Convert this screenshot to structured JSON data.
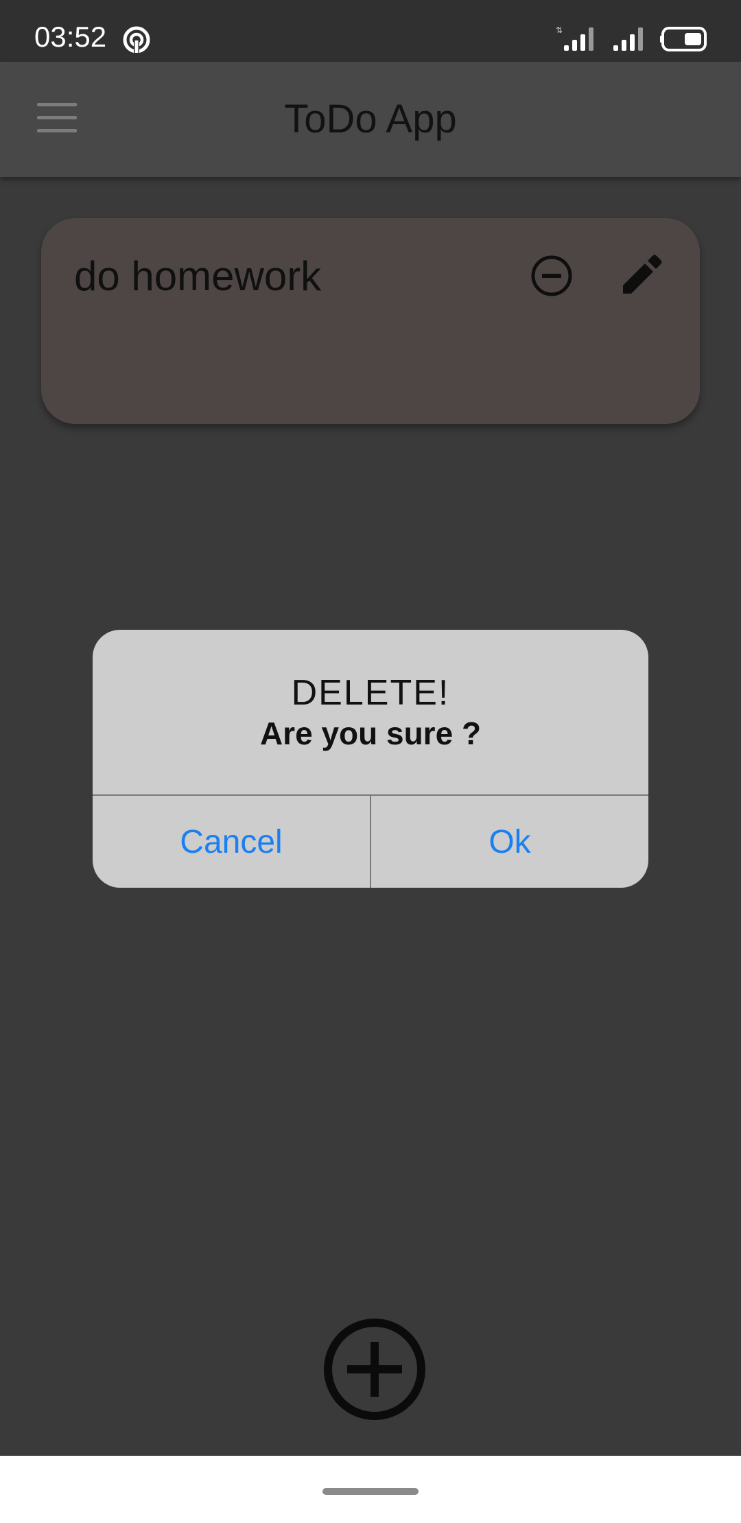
{
  "status_bar": {
    "time": "03:52",
    "icons": [
      "hotspot-icon",
      "signal-icon",
      "signal-icon",
      "battery-icon"
    ]
  },
  "app_bar": {
    "title": "ToDo App",
    "menu_icon": "menu-icon"
  },
  "todos": [
    {
      "text": "do homework",
      "actions": [
        "remove-circle-icon",
        "edit-pencil-icon"
      ]
    }
  ],
  "dialog": {
    "title": "DELETE!",
    "message": "Are you sure ?",
    "cancel_label": "Cancel",
    "ok_label": "Ok",
    "button_color": "#1a7ff0"
  },
  "fab": {
    "icon": "add-circle-icon"
  },
  "colors": {
    "background": "#3a3a3a",
    "app_bar": "#484848",
    "card": "#4e4645",
    "dialog": "#cdcdcd"
  }
}
